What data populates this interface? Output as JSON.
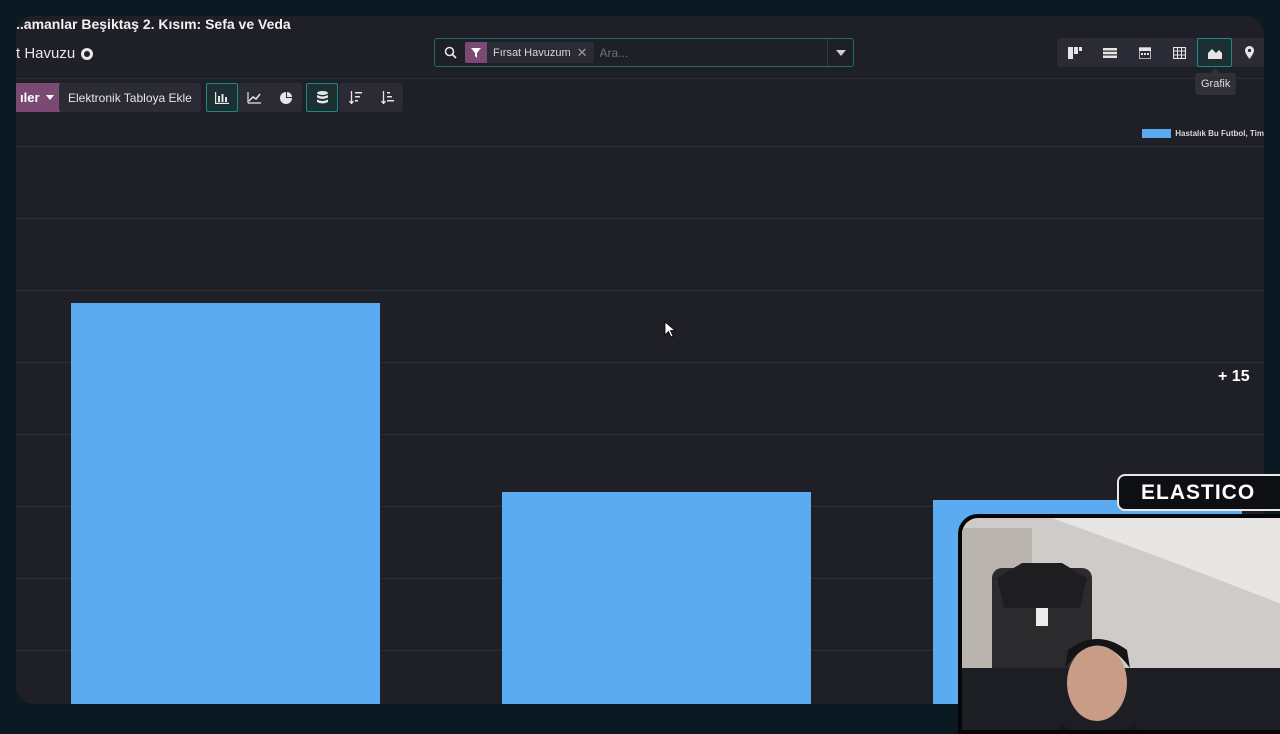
{
  "breadcrumb": {
    "title": "..amanlar Beşiktaş 2. Kısım: Sefa ve Veda"
  },
  "page": {
    "title": "t Havuzu"
  },
  "search": {
    "facet_label": "Fırsat Havuzum",
    "facet_remove": "✕",
    "placeholder": "Ara..."
  },
  "view_switcher": {
    "items": [
      "kanban-icon",
      "list-icon",
      "calendar-icon",
      "pivot-icon",
      "graph-icon",
      "map-icon"
    ],
    "active": "graph-icon",
    "tooltip": "Grafik"
  },
  "toolbar": {
    "dropdown_label": "ıler",
    "spreadsheet_label": "Elektronik Tabloya Ekle",
    "chart_type_buttons": [
      "bar-chart-icon",
      "line-chart-icon",
      "pie-chart-icon"
    ],
    "active_chart_type": "bar-chart-icon",
    "stack_button": "stack-icon",
    "sort_buttons": [
      "sort-descending-icon",
      "sort-ascending-icon"
    ]
  },
  "chart_data": {
    "type": "bar",
    "series": [
      {
        "name": "Hastalık Bu Futbol, Tim",
        "values": [
          5.3,
          2.8,
          2.7
        ]
      }
    ],
    "ylim": [
      0,
      7.5
    ],
    "grid": true,
    "legend_position": "top-right",
    "annotation": "+ 15"
  },
  "branding": {
    "watermark": "ELASTICO"
  },
  "colors": {
    "accent": "#1f8a85",
    "facet": "#7b4a72",
    "bar": "#5aabef"
  }
}
